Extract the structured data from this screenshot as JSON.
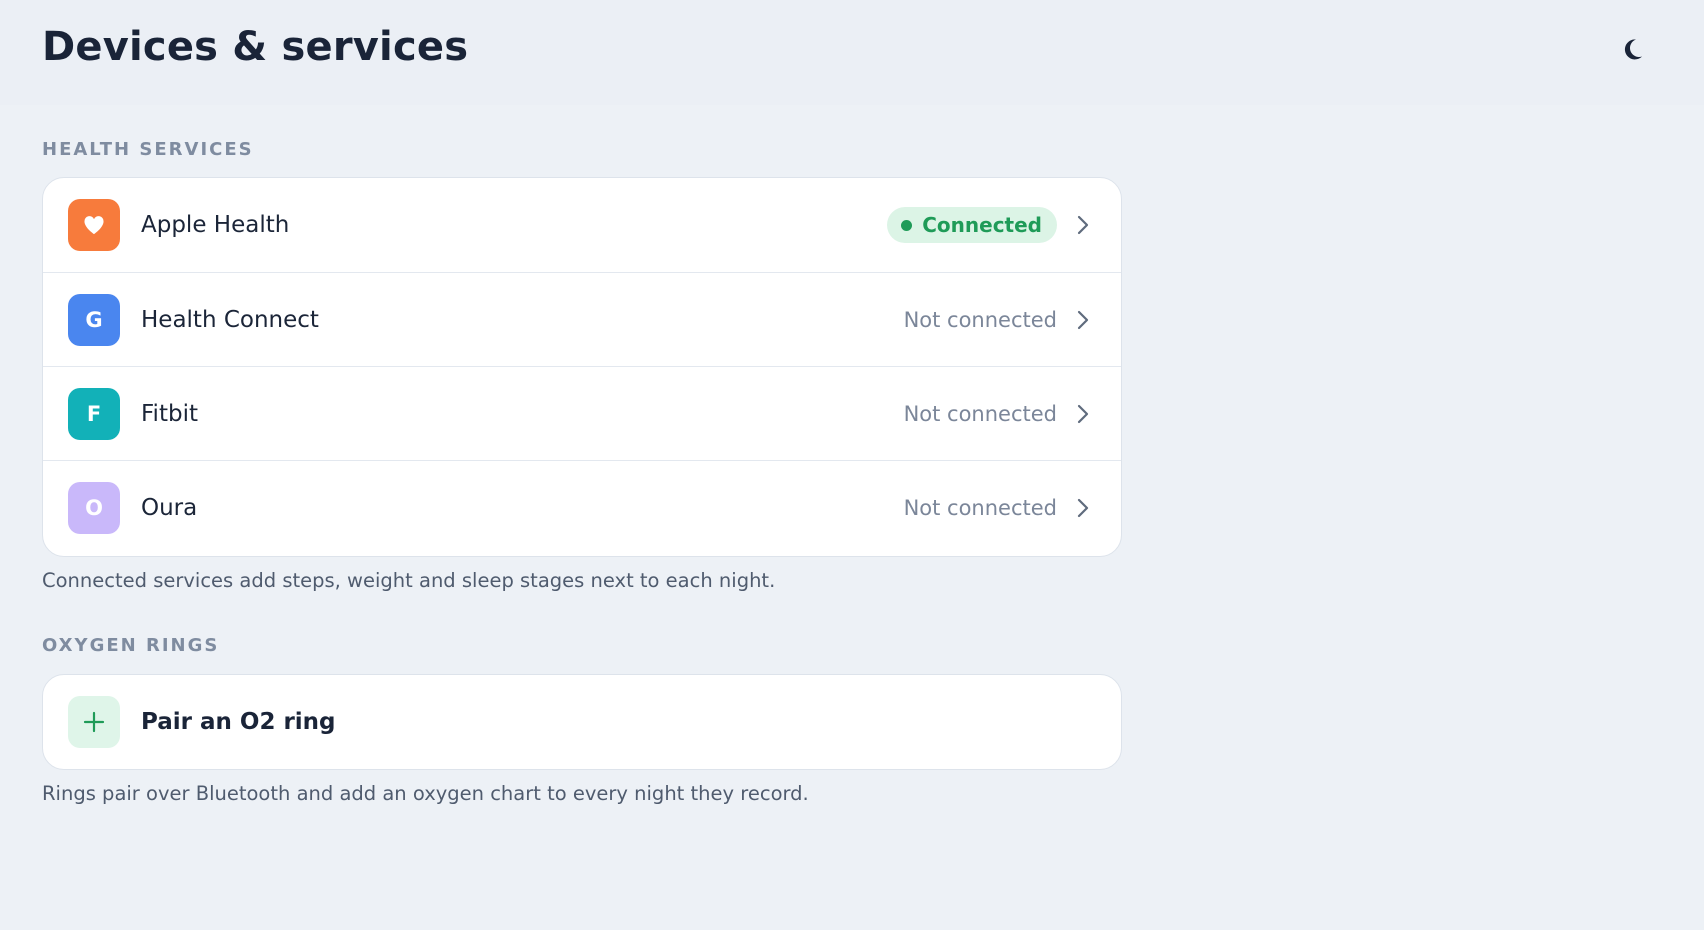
{
  "header": {
    "title": "Devices & services",
    "theme_toggle_icon": "moon-icon"
  },
  "health_services": {
    "section_label": "HEALTH SERVICES",
    "items": [
      {
        "name": "Apple Health",
        "icon": "heart-icon",
        "icon_color": "#f77b3c",
        "status": "Connected",
        "connected": true
      },
      {
        "name": "Health Connect",
        "icon_letter": "G",
        "icon_color": "#4a86ef",
        "status": "Not connected",
        "connected": false
      },
      {
        "name": "Fitbit",
        "icon_letter": "F",
        "icon_color": "#12b1b8",
        "status": "Not connected",
        "connected": false
      },
      {
        "name": "Oura",
        "icon_letter": "O",
        "icon_color": "#c9b8fa",
        "status": "Not connected",
        "connected": false
      }
    ],
    "footnote": "Connected services add steps, weight and sleep stages next to each night."
  },
  "oxygen_rings": {
    "section_label": "OXYGEN RINGS",
    "pair_label": "Pair an O2 ring",
    "pair_icon": "plus-icon",
    "footnote": "Rings pair over Bluetooth and add an oxygen chart to every night they record."
  },
  "colors": {
    "background": "#edf1f6",
    "connected_green": "#1f9b58",
    "connected_badge_bg": "#dcf4e6",
    "muted_text": "#7b8699"
  }
}
